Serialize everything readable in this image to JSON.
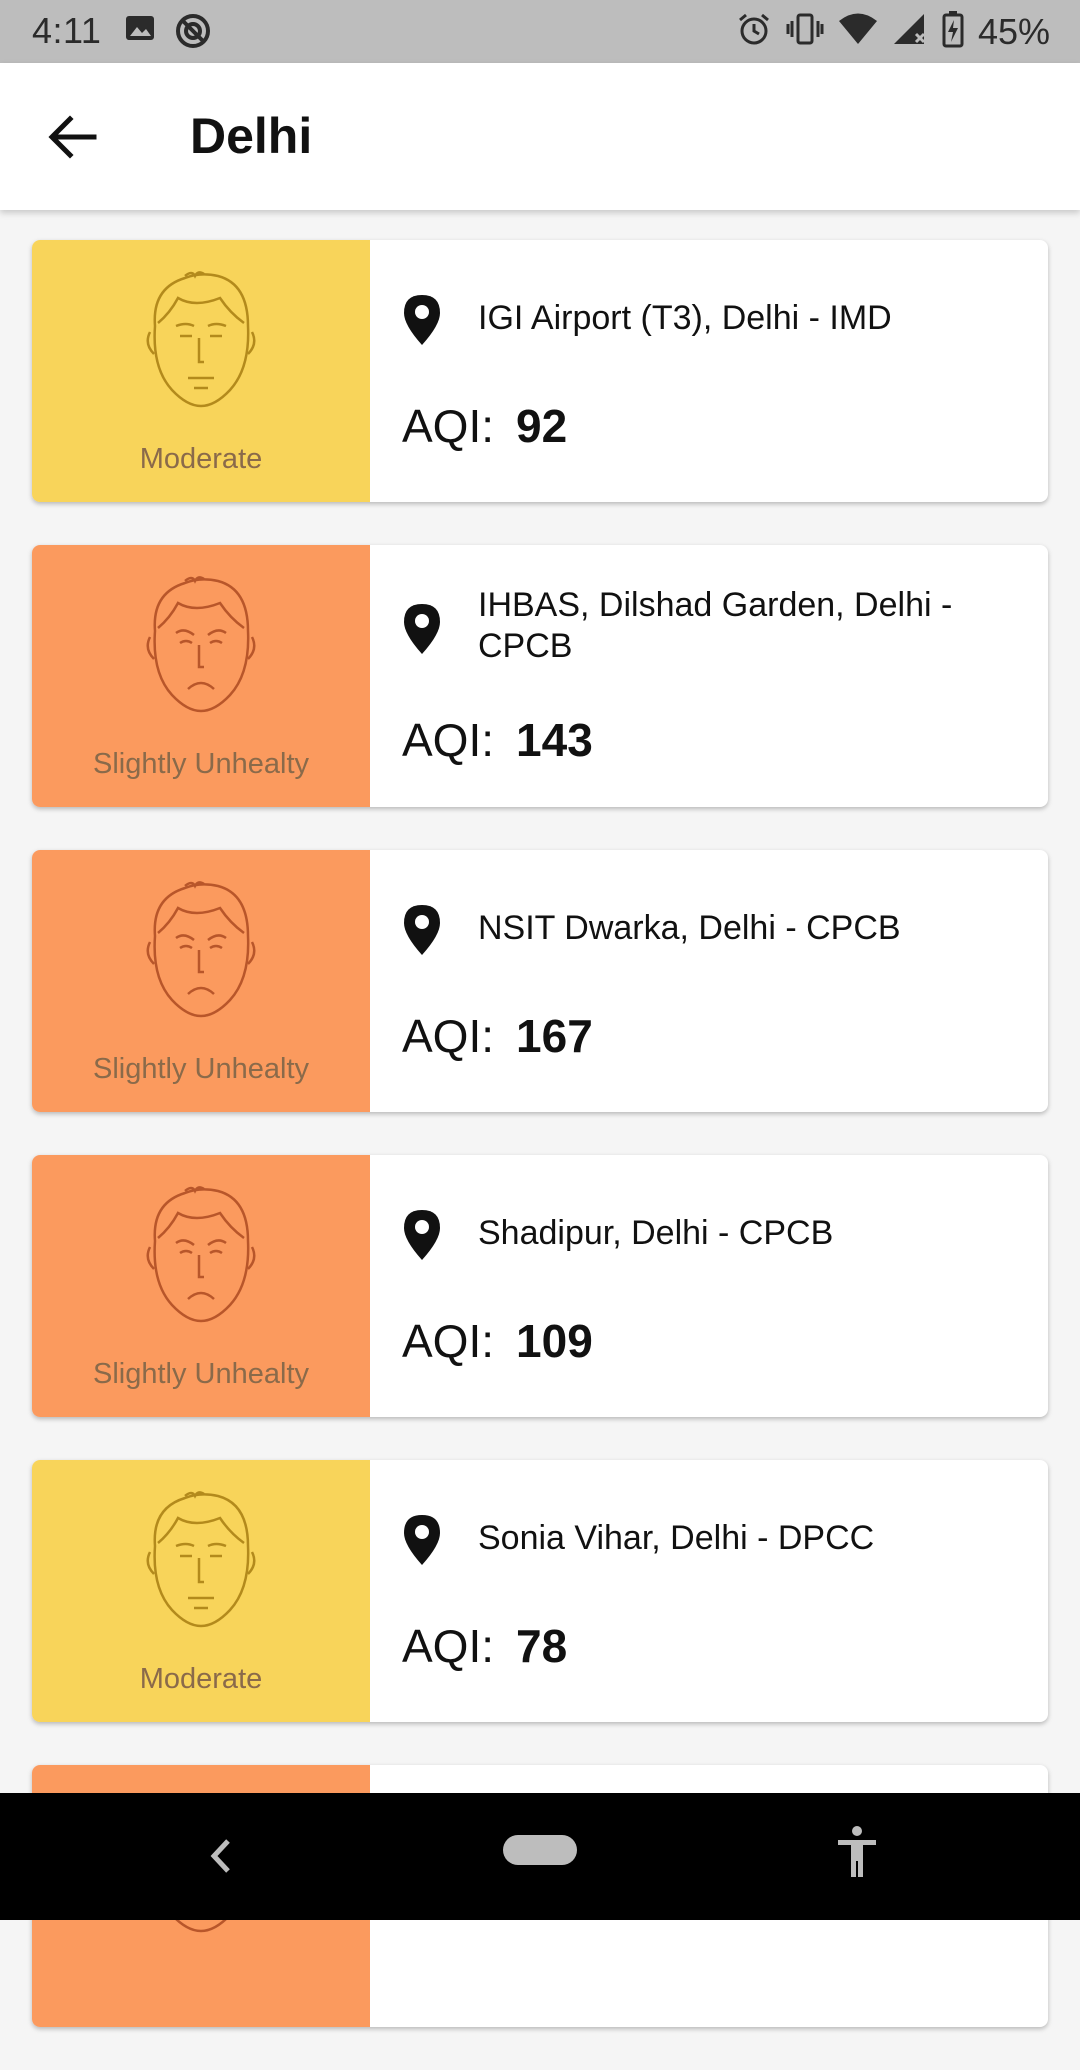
{
  "status_bar": {
    "time": "4:11",
    "battery": "45%",
    "left_icons": [
      "image-icon",
      "sync-disabled-icon"
    ],
    "right_icons": [
      "alarm-icon",
      "vibrate-icon",
      "wifi-icon",
      "signal-icon",
      "battery-charging-icon"
    ]
  },
  "app_bar": {
    "back_icon": "arrow-left-icon",
    "title": "Delhi"
  },
  "colors": {
    "moderate_bg": "#f8d45a",
    "moderate_fg": "#b38a1c",
    "unhealthy_bg": "#fb9a5e",
    "unhealthy_fg": "#b8562a",
    "label_text": "#8a6a4a"
  },
  "stations": [
    {
      "name": "IGI Airport (T3), Delhi - IMD",
      "aqi_label": "AQI:",
      "aqi": "92",
      "status": "Moderate",
      "level": "moderate"
    },
    {
      "name": "IHBAS, Dilshad Garden, Delhi - CPCB",
      "aqi_label": "AQI:",
      "aqi": "143",
      "status": "Slightly Unhealty",
      "level": "unhealthy"
    },
    {
      "name": "NSIT Dwarka, Delhi - CPCB",
      "aqi_label": "AQI:",
      "aqi": "167",
      "status": "Slightly Unhealty",
      "level": "unhealthy"
    },
    {
      "name": "Shadipur, Delhi - CPCB",
      "aqi_label": "AQI:",
      "aqi": "109",
      "status": "Slightly Unhealty",
      "level": "unhealthy"
    },
    {
      "name": "Sonia Vihar, Delhi - DPCC",
      "aqi_label": "AQI:",
      "aqi": "78",
      "status": "Moderate",
      "level": "moderate"
    },
    {
      "name": "",
      "aqi_label": "",
      "aqi": "",
      "status": "",
      "level": "unhealthy"
    }
  ],
  "nav_bar": {
    "icons": [
      "nav-back-icon",
      "nav-home-pill",
      "accessibility-icon"
    ]
  }
}
